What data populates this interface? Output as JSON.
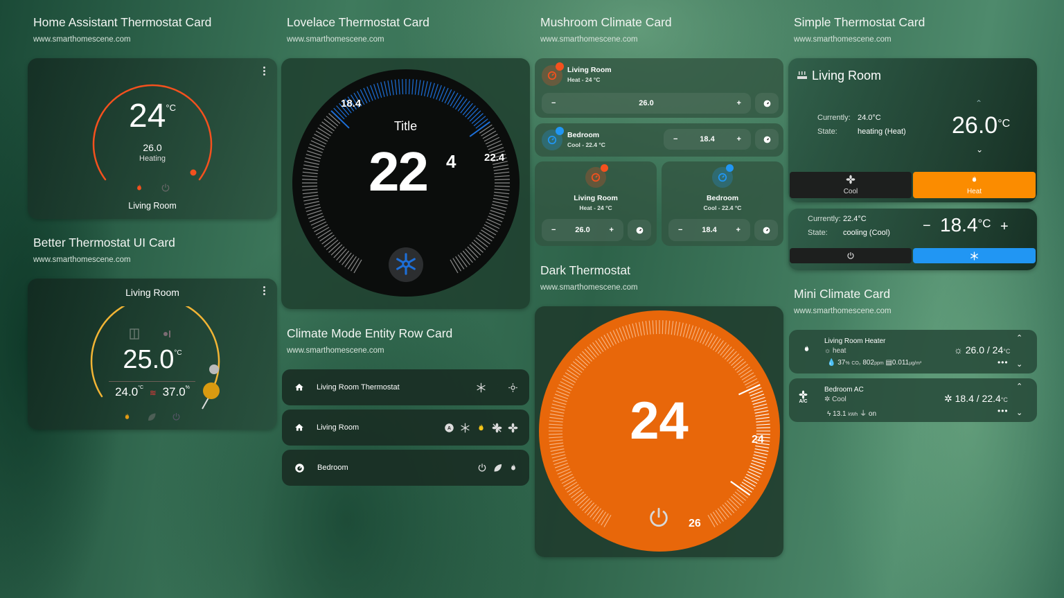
{
  "sections": {
    "ha_thermostat": {
      "title": "Home Assistant Thermostat Card",
      "subtitle": "www.smarthomescene.com"
    },
    "lovelace": {
      "title": "Lovelace Thermostat Card",
      "subtitle": "www.smarthomescene.com"
    },
    "mushroom": {
      "title": "Mushroom Climate Card",
      "subtitle": "www.smarthomescene.com"
    },
    "simple": {
      "title": "Simple Thermostat Card",
      "subtitle": "www.smarthomescene.com"
    },
    "better": {
      "title": "Better Thermostat UI Card",
      "subtitle": "www.smarthomescene.com"
    },
    "climate_mode": {
      "title": "Climate Mode Entity Row Card",
      "subtitle": "www.smarthomescene.com"
    },
    "dark": {
      "title": "Dark Thermostat",
      "subtitle": "www.smarthomescene.com"
    },
    "mini": {
      "title": "Mini Climate Card",
      "subtitle": "www.smarthomescene.com"
    }
  },
  "ha_card": {
    "target": "24",
    "unit": "°C",
    "current": "26.0",
    "action": "Heating",
    "name": "Living Room",
    "modes": [
      "heat",
      "off"
    ],
    "active_mode": "heat",
    "accent": "#f4511e",
    "target_fraction": 0.0
  },
  "better_card": {
    "name": "Living Room",
    "target": "25.0",
    "unit": "°C",
    "current_temp": "24.0",
    "current_temp_unit": "°C",
    "humidity": "37.0",
    "humidity_unit": "%",
    "modes": [
      "heat",
      "eco",
      "off"
    ],
    "accent": "#f2b535"
  },
  "lovelace_card": {
    "title": "Title",
    "target_int": "22",
    "target_dec": "4",
    "low_label": "18.4",
    "high_label": "22.4",
    "mode_icon": "snowflake-icon",
    "accent": "#1d6fd8"
  },
  "mushroom": {
    "rows": [
      {
        "name": "Living Room",
        "state": "Heat - 24 °C",
        "value": "26.0",
        "mode": "heat",
        "color": "#f4511e"
      },
      {
        "name": "Bedroom",
        "state": "Cool - 22.4 °C",
        "value": "18.4",
        "mode": "cool",
        "color": "#2196f3"
      }
    ],
    "tiles": [
      {
        "name": "Living Room",
        "state": "Heat - 24 °C",
        "value": "26.0",
        "mode": "heat",
        "color": "#f4511e"
      },
      {
        "name": "Bedroom",
        "state": "Cool - 22.4 °C",
        "value": "18.4",
        "mode": "cool",
        "color": "#2196f3"
      }
    ],
    "minus": "−",
    "plus": "+"
  },
  "simple_card": {
    "heater": {
      "name": "Living Room",
      "currently_label": "Currently:",
      "currently_value": "24.0°C",
      "state_label": "State:",
      "state_value": "heating (Heat)",
      "target": "26.0",
      "unit": "°C",
      "modes": [
        {
          "label": "Cool",
          "icon": "fan-icon",
          "active": false
        },
        {
          "label": "Heat",
          "icon": "fire-icon",
          "active": true
        }
      ],
      "active_color": "#fb8c00"
    },
    "cooler": {
      "currently_label": "Currently:",
      "currently_value": "22.4°C",
      "state_label": "State:",
      "state_value": "cooling (Cool)",
      "target": "18.4",
      "unit": "°C",
      "minus": "−",
      "plus": "+",
      "modes": [
        {
          "icon": "power-icon",
          "active": false
        },
        {
          "icon": "snowflake-icon",
          "active": true
        }
      ],
      "active_color": "#2196f3"
    }
  },
  "climate_mode_rows": [
    {
      "name": "Living Room Thermostat",
      "icon": "home-icon",
      "modes": [
        "snowflake-icon",
        "moon-icon",
        "sun-icon"
      ]
    },
    {
      "name": "Living Room",
      "icon": "home-icon",
      "modes": [
        "auto-icon",
        "snowflake-icon",
        "fire-icon",
        "fan-off-icon",
        "fan-icon"
      ],
      "active": "fire-icon"
    },
    {
      "name": "Bedroom",
      "icon": "thermostat-icon",
      "modes": [
        "power-icon",
        "leaf-icon",
        "fire-icon"
      ]
    }
  ],
  "dark_card": {
    "target": "24",
    "current_label": "24",
    "setpoint_label": "26",
    "accent": "#e8670a"
  },
  "mini_climate": [
    {
      "name": "Living Room Heater",
      "mode": "heat",
      "humidity": "37",
      "humidity_unit": "%",
      "co2_label": "CO₂",
      "co2": "802",
      "co2_unit": "ppm",
      "pm": "0.011",
      "pm_unit": "µg/m³",
      "temps": "26.0 / 24",
      "unit": "°C",
      "icon": "fire-icon"
    },
    {
      "name": "Bedroom AC",
      "mode": "Cool",
      "energy": "13.1",
      "energy_unit": "kWh",
      "plug": "on",
      "temps": "18.4 / 22.4",
      "unit": "°C",
      "icon": "air-conditioner-icon",
      "icon_label": "A/C"
    }
  ]
}
